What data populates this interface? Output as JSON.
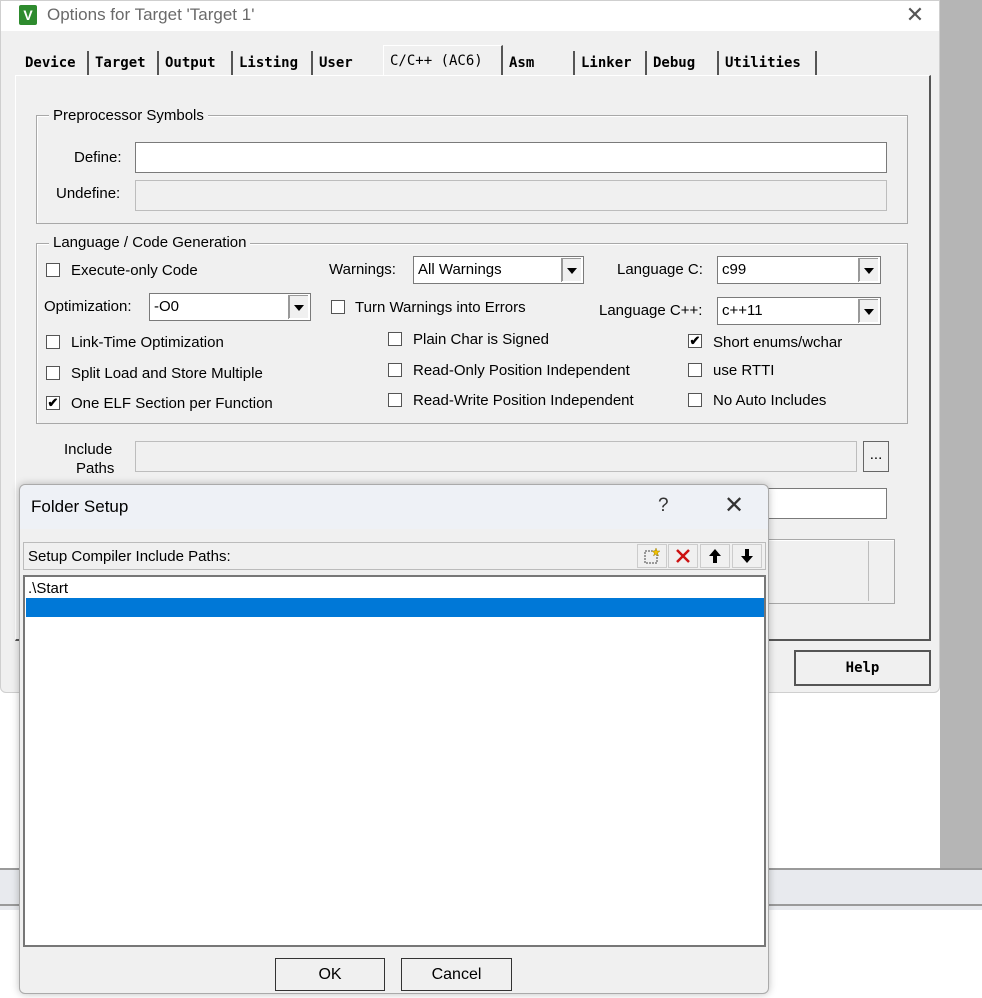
{
  "main": {
    "title": "Options for Target 'Target 1'",
    "app_icon_letter": "V",
    "close": "✕",
    "tabs": [
      "Device",
      "Target",
      "Output",
      "Listing",
      "User",
      "C/C++ (AC6)",
      "Asm",
      "Linker",
      "Debug",
      "Utilities"
    ],
    "active_tab": "C/C++ (AC6)"
  },
  "preprocessor": {
    "title": "Preprocessor Symbols",
    "define_label": "Define:",
    "define_value": "",
    "undefine_label": "Undefine:",
    "undefine_value": ""
  },
  "language": {
    "title": "Language / Code Generation",
    "execute_only": {
      "label": "Execute-only Code",
      "checked": false
    },
    "warnings_label": "Warnings:",
    "warnings_value": "All Warnings",
    "language_c_label": "Language C:",
    "language_c_value": "c99",
    "optimization_label": "Optimization:",
    "optimization_value": "-O0",
    "warnings_errors": {
      "label": "Turn Warnings into Errors",
      "checked": false
    },
    "language_cpp_label": "Language C++:",
    "language_cpp_value": "c++11",
    "link_time": {
      "label": "Link-Time Optimization",
      "checked": false
    },
    "plain_char": {
      "label": "Plain Char is Signed",
      "checked": false
    },
    "short_enums": {
      "label": "Short enums/wchar",
      "checked": true
    },
    "split_load": {
      "label": "Split Load and Store Multiple",
      "checked": false
    },
    "ro_pi": {
      "label": "Read-Only Position Independent",
      "checked": false
    },
    "rtti": {
      "label": "use RTTI",
      "checked": false
    },
    "one_elf": {
      "label": "One ELF Section per Function",
      "checked": true
    },
    "rw_pi": {
      "label": "Read-Write Position Independent",
      "checked": false
    },
    "no_auto": {
      "label": "No Auto Includes",
      "checked": false
    }
  },
  "include": {
    "label_line1": "Include",
    "label_line2": "Paths",
    "browse": "...",
    "value": ""
  },
  "help_button": "Help",
  "folder_setup": {
    "title": "Folder Setup",
    "help": "?",
    "close": "✕",
    "header_label": "Setup Compiler Include Paths:",
    "tools": {
      "new": "new-folder-icon",
      "delete": "delete-icon",
      "up": "arrow-up-icon",
      "down": "arrow-down-icon"
    },
    "items": [
      ".\\Start",
      ""
    ],
    "selected_index": 1,
    "ok": "OK",
    "cancel": "Cancel"
  },
  "colors": {
    "selection": "#0078d7",
    "delete_icon": "#cc1111",
    "app_icon": "#2e8b2e"
  }
}
